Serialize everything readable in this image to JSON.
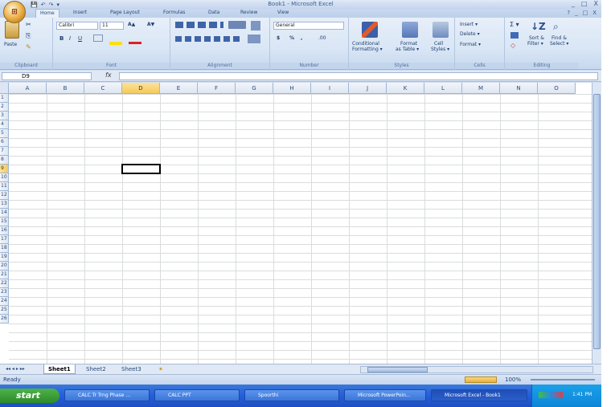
{
  "window": {
    "title": "Book1 - Microsoft Excel",
    "office_button": "⊞",
    "controls": [
      "_",
      "□",
      "X"
    ],
    "help_controls": [
      "?",
      "_",
      "□",
      "X"
    ]
  },
  "quick_access": [
    "💾",
    "↶",
    "↷",
    "▾"
  ],
  "tabs": [
    "Home",
    "Insert",
    "Page Layout",
    "Formulas",
    "Data",
    "Review",
    "View"
  ],
  "ribbon": {
    "clipboard": {
      "paste": "Paste",
      "label": "Clipboard"
    },
    "font": {
      "name": "Calibri",
      "size": "11",
      "bold": "B",
      "italic": "I",
      "underline": "U",
      "grow": "A▲",
      "shrink": "A▼",
      "label": "Font"
    },
    "alignment": {
      "label": "Alignment"
    },
    "number": {
      "format": "General",
      "currency": "$",
      "percent": "%",
      "comma": ",",
      "inc_dec": ".00",
      "label": "Number"
    },
    "styles": {
      "conditional": "Conditional",
      "conditional2": "Formatting ▾",
      "format_table": "Format",
      "format_table2": "as Table ▾",
      "cell_styles": "Cell",
      "cell_styles2": "Styles ▾",
      "label": "Styles"
    },
    "cells": {
      "insert": "Insert ▾",
      "delete": "Delete ▾",
      "format": "Format ▾",
      "label": "Cells"
    },
    "editing": {
      "sum": "Σ ▾",
      "sort": "Sort &",
      "sort2": "Filter ▾",
      "find": "Find &",
      "find2": "Select ▾",
      "label": "Editing"
    }
  },
  "formula_bar": {
    "name_box": "D9",
    "fx": "fx",
    "value": ""
  },
  "columns": [
    "A",
    "B",
    "C",
    "D",
    "E",
    "F",
    "G",
    "H",
    "I",
    "J",
    "K",
    "L",
    "M",
    "N",
    "O"
  ],
  "rows": [
    "1",
    "2",
    "3",
    "4",
    "5",
    "6",
    "7",
    "8",
    "9",
    "10",
    "11",
    "12",
    "13",
    "14",
    "15",
    "16",
    "17",
    "18",
    "19",
    "20",
    "21",
    "22",
    "23",
    "24",
    "25",
    "26"
  ],
  "selected": {
    "column": "D",
    "row": "9"
  },
  "sheets": [
    "Sheet1",
    "Sheet2",
    "Sheet3"
  ],
  "sheet_nav": "◂◂ ◂ ▸ ▸▸",
  "status": {
    "ready": "Ready",
    "zoom": "100%"
  },
  "taskbar": {
    "start": "start",
    "items": [
      "CALC Tr Trng Phase ...",
      "CALC PPT",
      "Spoorthi",
      "Microsoft PowerPoin...",
      "Microsoft Excel - Book1"
    ],
    "clock": "1:41 PM"
  },
  "colors": {
    "selection_header": "#f6c95c",
    "ribbon_bg": "#dbe6f5",
    "taskbar": "#245edb",
    "start_green": "#2e8b2b"
  }
}
